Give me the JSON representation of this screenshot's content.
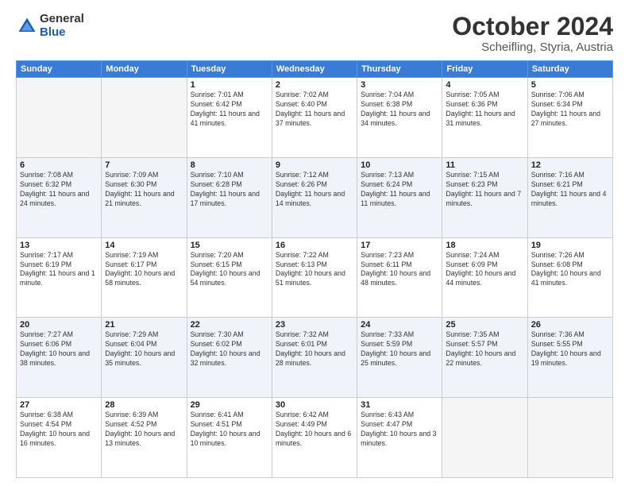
{
  "logo": {
    "general": "General",
    "blue": "Blue"
  },
  "title": "October 2024",
  "subtitle": "Scheifling, Styria, Austria",
  "days_of_week": [
    "Sunday",
    "Monday",
    "Tuesday",
    "Wednesday",
    "Thursday",
    "Friday",
    "Saturday"
  ],
  "weeks": [
    [
      {
        "day": "",
        "empty": true
      },
      {
        "day": "",
        "empty": true
      },
      {
        "day": "1",
        "sunrise": "Sunrise: 7:01 AM",
        "sunset": "Sunset: 6:42 PM",
        "daylight": "Daylight: 11 hours and 41 minutes."
      },
      {
        "day": "2",
        "sunrise": "Sunrise: 7:02 AM",
        "sunset": "Sunset: 6:40 PM",
        "daylight": "Daylight: 11 hours and 37 minutes."
      },
      {
        "day": "3",
        "sunrise": "Sunrise: 7:04 AM",
        "sunset": "Sunset: 6:38 PM",
        "daylight": "Daylight: 11 hours and 34 minutes."
      },
      {
        "day": "4",
        "sunrise": "Sunrise: 7:05 AM",
        "sunset": "Sunset: 6:36 PM",
        "daylight": "Daylight: 11 hours and 31 minutes."
      },
      {
        "day": "5",
        "sunrise": "Sunrise: 7:06 AM",
        "sunset": "Sunset: 6:34 PM",
        "daylight": "Daylight: 11 hours and 27 minutes."
      }
    ],
    [
      {
        "day": "6",
        "sunrise": "Sunrise: 7:08 AM",
        "sunset": "Sunset: 6:32 PM",
        "daylight": "Daylight: 11 hours and 24 minutes."
      },
      {
        "day": "7",
        "sunrise": "Sunrise: 7:09 AM",
        "sunset": "Sunset: 6:30 PM",
        "daylight": "Daylight: 11 hours and 21 minutes."
      },
      {
        "day": "8",
        "sunrise": "Sunrise: 7:10 AM",
        "sunset": "Sunset: 6:28 PM",
        "daylight": "Daylight: 11 hours and 17 minutes."
      },
      {
        "day": "9",
        "sunrise": "Sunrise: 7:12 AM",
        "sunset": "Sunset: 6:26 PM",
        "daylight": "Daylight: 11 hours and 14 minutes."
      },
      {
        "day": "10",
        "sunrise": "Sunrise: 7:13 AM",
        "sunset": "Sunset: 6:24 PM",
        "daylight": "Daylight: 11 hours and 11 minutes."
      },
      {
        "day": "11",
        "sunrise": "Sunrise: 7:15 AM",
        "sunset": "Sunset: 6:23 PM",
        "daylight": "Daylight: 11 hours and 7 minutes."
      },
      {
        "day": "12",
        "sunrise": "Sunrise: 7:16 AM",
        "sunset": "Sunset: 6:21 PM",
        "daylight": "Daylight: 11 hours and 4 minutes."
      }
    ],
    [
      {
        "day": "13",
        "sunrise": "Sunrise: 7:17 AM",
        "sunset": "Sunset: 6:19 PM",
        "daylight": "Daylight: 11 hours and 1 minute."
      },
      {
        "day": "14",
        "sunrise": "Sunrise: 7:19 AM",
        "sunset": "Sunset: 6:17 PM",
        "daylight": "Daylight: 10 hours and 58 minutes."
      },
      {
        "day": "15",
        "sunrise": "Sunrise: 7:20 AM",
        "sunset": "Sunset: 6:15 PM",
        "daylight": "Daylight: 10 hours and 54 minutes."
      },
      {
        "day": "16",
        "sunrise": "Sunrise: 7:22 AM",
        "sunset": "Sunset: 6:13 PM",
        "daylight": "Daylight: 10 hours and 51 minutes."
      },
      {
        "day": "17",
        "sunrise": "Sunrise: 7:23 AM",
        "sunset": "Sunset: 6:11 PM",
        "daylight": "Daylight: 10 hours and 48 minutes."
      },
      {
        "day": "18",
        "sunrise": "Sunrise: 7:24 AM",
        "sunset": "Sunset: 6:09 PM",
        "daylight": "Daylight: 10 hours and 44 minutes."
      },
      {
        "day": "19",
        "sunrise": "Sunrise: 7:26 AM",
        "sunset": "Sunset: 6:08 PM",
        "daylight": "Daylight: 10 hours and 41 minutes."
      }
    ],
    [
      {
        "day": "20",
        "sunrise": "Sunrise: 7:27 AM",
        "sunset": "Sunset: 6:06 PM",
        "daylight": "Daylight: 10 hours and 38 minutes."
      },
      {
        "day": "21",
        "sunrise": "Sunrise: 7:29 AM",
        "sunset": "Sunset: 6:04 PM",
        "daylight": "Daylight: 10 hours and 35 minutes."
      },
      {
        "day": "22",
        "sunrise": "Sunrise: 7:30 AM",
        "sunset": "Sunset: 6:02 PM",
        "daylight": "Daylight: 10 hours and 32 minutes."
      },
      {
        "day": "23",
        "sunrise": "Sunrise: 7:32 AM",
        "sunset": "Sunset: 6:01 PM",
        "daylight": "Daylight: 10 hours and 28 minutes."
      },
      {
        "day": "24",
        "sunrise": "Sunrise: 7:33 AM",
        "sunset": "Sunset: 5:59 PM",
        "daylight": "Daylight: 10 hours and 25 minutes."
      },
      {
        "day": "25",
        "sunrise": "Sunrise: 7:35 AM",
        "sunset": "Sunset: 5:57 PM",
        "daylight": "Daylight: 10 hours and 22 minutes."
      },
      {
        "day": "26",
        "sunrise": "Sunrise: 7:36 AM",
        "sunset": "Sunset: 5:55 PM",
        "daylight": "Daylight: 10 hours and 19 minutes."
      }
    ],
    [
      {
        "day": "27",
        "sunrise": "Sunrise: 6:38 AM",
        "sunset": "Sunset: 4:54 PM",
        "daylight": "Daylight: 10 hours and 16 minutes."
      },
      {
        "day": "28",
        "sunrise": "Sunrise: 6:39 AM",
        "sunset": "Sunset: 4:52 PM",
        "daylight": "Daylight: 10 hours and 13 minutes."
      },
      {
        "day": "29",
        "sunrise": "Sunrise: 6:41 AM",
        "sunset": "Sunset: 4:51 PM",
        "daylight": "Daylight: 10 hours and 10 minutes."
      },
      {
        "day": "30",
        "sunrise": "Sunrise: 6:42 AM",
        "sunset": "Sunset: 4:49 PM",
        "daylight": "Daylight: 10 hours and 6 minutes."
      },
      {
        "day": "31",
        "sunrise": "Sunrise: 6:43 AM",
        "sunset": "Sunset: 4:47 PM",
        "daylight": "Daylight: 10 hours and 3 minutes."
      },
      {
        "day": "",
        "empty": true
      },
      {
        "day": "",
        "empty": true
      }
    ]
  ]
}
